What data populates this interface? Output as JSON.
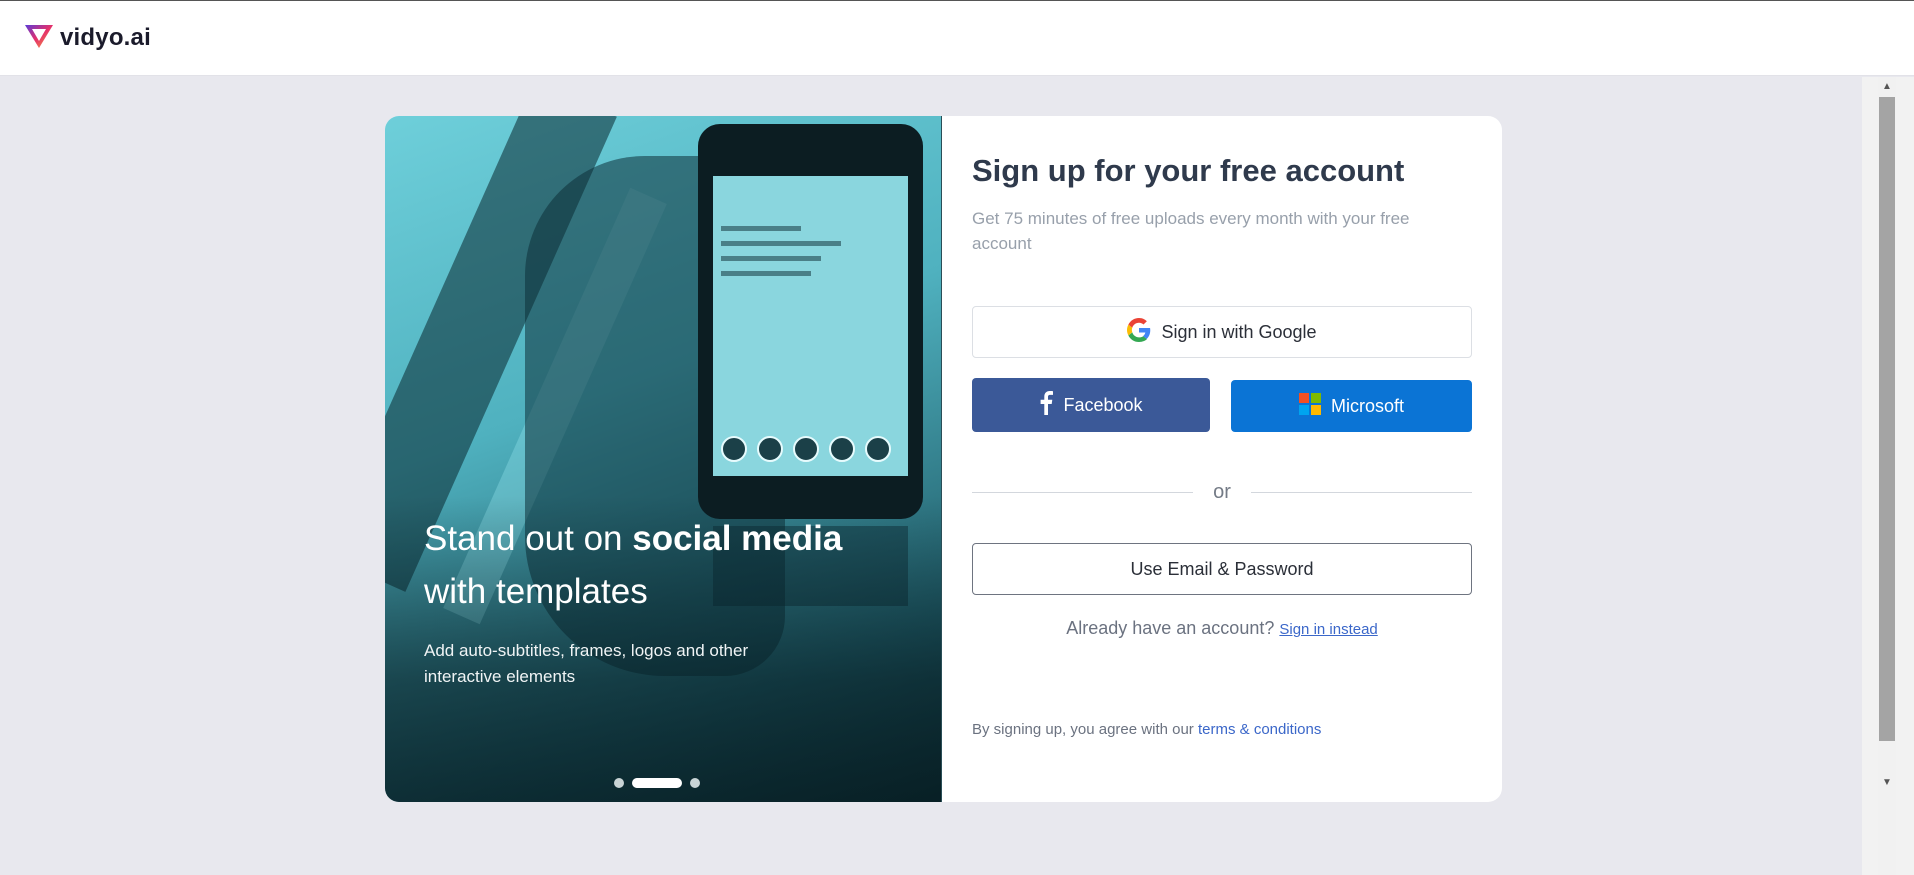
{
  "header": {
    "brand": "vidyo.ai",
    "logo_icon": "vidyo-logo-icon"
  },
  "hero": {
    "title_part1": "Stand out on ",
    "title_bold": "social media",
    "title_part2": "with templates",
    "subtitle": "Add auto-subtitles, frames, logos and other interactive elements",
    "carousel": {
      "count": 3,
      "active_index": 1
    }
  },
  "form": {
    "title": "Sign up for your free account",
    "subtitle": "Get 75 minutes of free uploads every month with your free account",
    "google_label": "Sign in with Google",
    "facebook_label": "Facebook",
    "microsoft_label": "Microsoft",
    "divider_text": "or",
    "email_label": "Use Email & Password",
    "have_account_text": "Already have an account?",
    "sign_in_link": "Sign in instead",
    "agree_text": "By signing up, you agree with our",
    "terms_link": "terms & conditions"
  },
  "colors": {
    "facebook": "#3b5998",
    "microsoft": "#0b74d5",
    "link": "#3b67c9",
    "title": "#2f3a4c"
  }
}
